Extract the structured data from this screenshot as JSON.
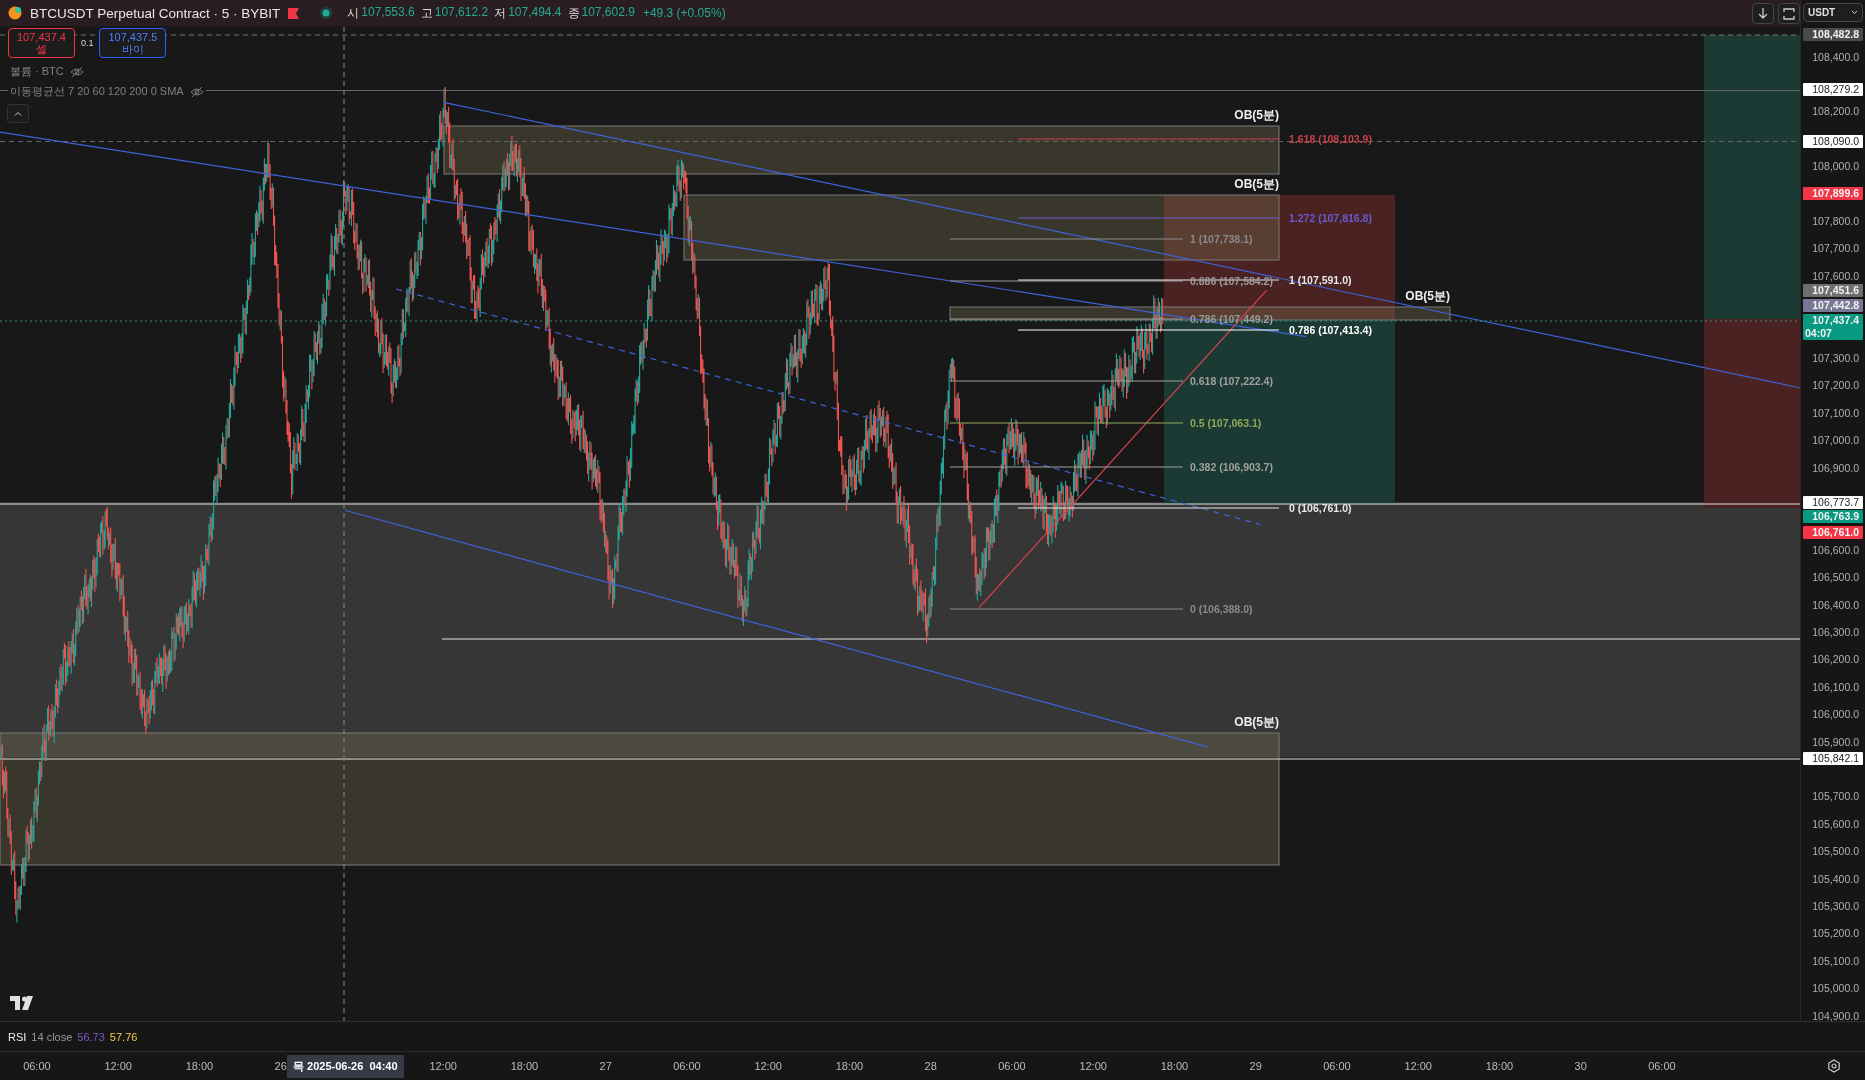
{
  "header": {
    "symbol": "BTCUSDT Perpetual Contract · 5 · BYBIT",
    "ohlc": [
      {
        "label": "시",
        "value": "107,553.6"
      },
      {
        "label": "고",
        "value": "107,612.2"
      },
      {
        "label": "저",
        "value": "107,494.4"
      },
      {
        "label": "종",
        "value": "107,602.9"
      }
    ],
    "change": "+49.3 (+0.05%)"
  },
  "trade": {
    "sell": {
      "price": "107,437.4",
      "label": "셀"
    },
    "quantity": "0.1",
    "buy": {
      "price": "107,437.5",
      "label": "바이"
    }
  },
  "legend": [
    {
      "text": "볼륨 · BTC",
      "visible": false
    },
    {
      "text": "이동평균선 7 20 60 120 200 0 SMA",
      "visible": false
    }
  ],
  "toolbar": {
    "currency": "USDT"
  },
  "drawings": {
    "order_blocks": [
      "OB(5분)",
      "OB(5분)",
      "OB(5분)",
      "OB(5분)"
    ],
    "fib_inner": [
      {
        "text": "1 (107,738.1)",
        "color": "#8a8a8a"
      },
      {
        "text": "0.886 (107,584.2)",
        "color": "#9a9a9a"
      },
      {
        "text": "0.786 (107,449.2)",
        "color": "#9a9a9a"
      },
      {
        "text": "0.618 (107,222.4)",
        "color": "#a0a0a0"
      },
      {
        "text": "0.5 (107,063.1)",
        "color": "#8fa85a"
      },
      {
        "text": "0.382 (106,903.7)",
        "color": "#a0a0a0"
      },
      {
        "text": "0 (106,388.0)",
        "color": "#8a8a8a"
      }
    ],
    "fib_outer": [
      {
        "text": "1.618 (108,103.9)",
        "color": "#c8414a"
      },
      {
        "text": "1.272 (107,816.8)",
        "color": "#6a5acd"
      },
      {
        "text": "1 (107,591.0)",
        "color": "#e8e8e8"
      },
      {
        "text": "0.786 (107,413.4)",
        "color": "#ffffff"
      },
      {
        "text": "0 (106,761.0)",
        "color": "#e8e8e8"
      }
    ]
  },
  "price_axis": {
    "ticks": [
      "108,400.0",
      "108,200.0",
      "108,000.0",
      "107,800.0",
      "107,700.0",
      "107,600.0",
      "107,300.0",
      "107,200.0",
      "107,100.0",
      "107,000.0",
      "106,900.0",
      "106,600.0",
      "106,500.0",
      "106,400.0",
      "106,300.0",
      "106,200.0",
      "106,100.0",
      "106,000.0",
      "105,900.0",
      "105,700.0",
      "105,600.0",
      "105,500.0",
      "105,400.0",
      "105,300.0",
      "105,200.0",
      "105,100.0",
      "105,000.0",
      "104,900.0"
    ],
    "badges": [
      {
        "text": "108,482.8",
        "color": "#4a4a4a"
      },
      {
        "text": "108,279.2",
        "color": "#ffffff"
      },
      {
        "text": "108,090.0",
        "color": "#ffffff"
      },
      {
        "text": "107,899.6",
        "color": "#f23645"
      },
      {
        "text": "107,451.6",
        "color": "#6e6e6e"
      },
      {
        "text": "107,442.8",
        "color": "#787896"
      },
      {
        "text": "107,437.4",
        "sub": "04:07",
        "color": "#089981"
      },
      {
        "text": "106,773.7",
        "color": "#ffffff"
      },
      {
        "text": "106,763.9",
        "color": "#089981"
      },
      {
        "text": "106,761.0",
        "color": "#f23645"
      },
      {
        "text": "105,842.1",
        "color": "#ffffff"
      }
    ]
  },
  "rsi": {
    "label": "RSI",
    "params": "14 close",
    "values": [
      "56.73",
      "57.76"
    ]
  },
  "time_axis": {
    "ticks": [
      "06:00",
      "12:00",
      "18:00",
      "26",
      "12:00",
      "18:00",
      "27",
      "06:00",
      "12:00",
      "18:00",
      "28",
      "06:00",
      "12:00",
      "18:00",
      "29",
      "06:00",
      "12:00",
      "18:00",
      "30",
      "06:00"
    ],
    "crosshair": "목 2025-06-26  04:40"
  }
}
